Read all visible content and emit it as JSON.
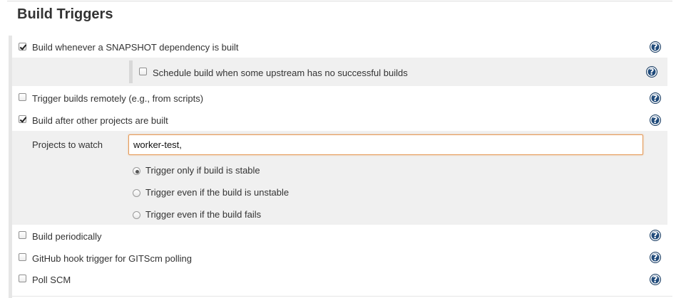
{
  "section": {
    "title": "Build Triggers"
  },
  "triggers": {
    "snapshot": {
      "label": "Build whenever a SNAPSHOT dependency is built",
      "checked": true
    },
    "schedule_upstream": {
      "label": "Schedule build when some upstream has no successful builds",
      "checked": false
    },
    "remote": {
      "label": "Trigger builds remotely (e.g., from scripts)",
      "checked": false
    },
    "after_other": {
      "label": "Build after other projects are built",
      "checked": true
    },
    "periodically": {
      "label": "Build periodically",
      "checked": false
    },
    "github_hook": {
      "label": "GitHub hook trigger for GITScm polling",
      "checked": false
    },
    "poll_scm": {
      "label": "Poll SCM",
      "checked": false
    }
  },
  "projects_to_watch": {
    "label": "Projects to watch",
    "value": "worker-test, "
  },
  "threshold_options": [
    {
      "label": "Trigger only if build is stable",
      "selected": true
    },
    {
      "label": "Trigger even if the build is unstable",
      "selected": false
    },
    {
      "label": "Trigger even if the build fails",
      "selected": false
    }
  ],
  "help_icon": {
    "glyph": "?"
  },
  "colors": {
    "help_icon_bg": "#1f4a7a",
    "focus_border": "#e59a58",
    "panel_bg": "#f0f0f0"
  }
}
